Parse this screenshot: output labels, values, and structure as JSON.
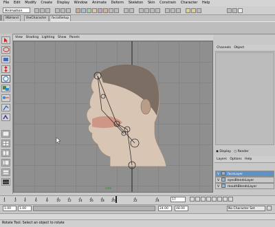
{
  "menubar": {
    "items": [
      "File",
      "Edit",
      "Modify",
      "Create",
      "Display",
      "Window",
      "Animate",
      "Deform",
      "Skeleton",
      "Skin",
      "Constrain",
      "Character",
      "Help"
    ]
  },
  "statusline": {
    "mode": "Animation"
  },
  "shelf": {
    "tabs": [
      "IKbHand",
      "theCharacter",
      "facialSetup"
    ],
    "active_tab": "facialSetup"
  },
  "viewport": {
    "menu": [
      "View",
      "Shading",
      "Lighting",
      "Show",
      "Panels"
    ],
    "camera": "side"
  },
  "channelbox": {
    "tabs": [
      "Channels",
      "Object"
    ]
  },
  "layers": {
    "display_label": "Display",
    "render_label": "Render",
    "menu": [
      "Layers",
      "Options",
      "Help"
    ],
    "rows": [
      {
        "v": "V",
        "name": "faceLayer",
        "selected": true
      },
      {
        "v": "V",
        "name": "eyesBlendsLayer",
        "selected": false
      },
      {
        "v": "V",
        "name": "mouthBlendsLayer",
        "selected": false
      }
    ]
  },
  "timeslider": {
    "ticks": [
      "1",
      "2",
      "4",
      "6",
      "8",
      "10",
      "12",
      "14",
      "16",
      "18",
      "20",
      "22",
      "24"
    ],
    "current_frame": "17"
  },
  "range": {
    "start": "1.00",
    "inner_start": "1.00",
    "inner_end": "24.00",
    "end": "48.00",
    "character_set": "No Character Set"
  },
  "helpline": {
    "text": "Rotate Tool: Select an object to rotate"
  },
  "colors": {
    "viewport_bg": "#8f8f8f",
    "selected_layer": "#5f91c4",
    "skin": "#d8c3b0",
    "hair": "#6a5d52"
  }
}
